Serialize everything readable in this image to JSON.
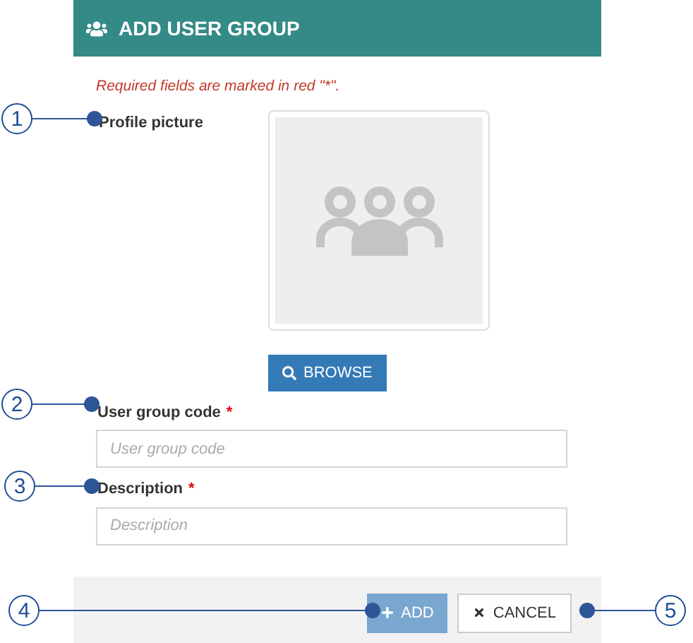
{
  "dialog": {
    "title": "ADD USER GROUP"
  },
  "required_note": "Required fields are marked in red \"*\".",
  "profile_picture": {
    "label": "Profile picture",
    "browse_button": "BROWSE"
  },
  "fields": [
    {
      "label": "User group code",
      "required_mark": "*",
      "placeholder": "User group code"
    },
    {
      "label": "Description",
      "required_mark": "*",
      "placeholder": "Description"
    }
  ],
  "footer": {
    "buttons": [
      {
        "kind": "primary",
        "label": "ADD",
        "disabled": true
      },
      {
        "kind": "cancel",
        "label": "CANCEL"
      }
    ]
  },
  "callouts": [
    {
      "number": "1"
    },
    {
      "number": "2"
    },
    {
      "number": "3"
    },
    {
      "number": "4"
    },
    {
      "number": "5"
    }
  ]
}
